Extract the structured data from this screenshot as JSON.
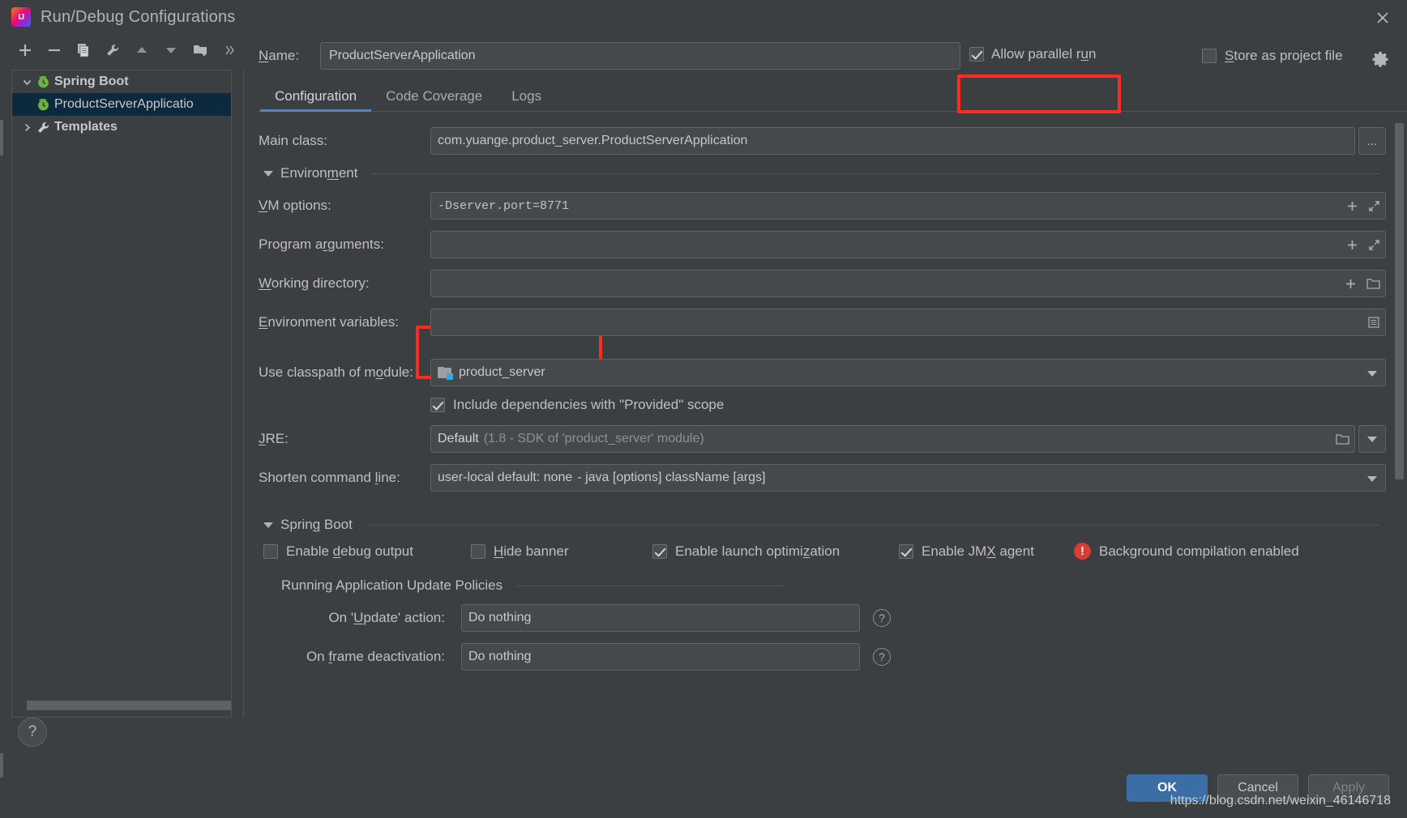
{
  "window": {
    "title": "Run/Debug Configurations",
    "logo_icon": "intellij-idea-logo",
    "close_icon": "close-icon"
  },
  "toolbar": {
    "buttons": [
      {
        "name": "add",
        "icon": "plus-icon"
      },
      {
        "name": "remove",
        "icon": "minus-icon"
      },
      {
        "name": "copy",
        "icon": "copy-icon"
      },
      {
        "name": "edit-templates",
        "icon": "wrench-icon"
      },
      {
        "name": "move-up",
        "icon": "arrow-up-icon"
      },
      {
        "name": "move-down",
        "icon": "arrow-down-icon"
      },
      {
        "name": "new-folder",
        "icon": "folder-add-icon"
      },
      {
        "name": "more",
        "icon": "chevron-double-right-icon"
      }
    ]
  },
  "tree": {
    "nodes": [
      {
        "label": "Spring Boot",
        "icon": "spring-boot-icon",
        "expanded": true,
        "selected": false
      },
      {
        "label": "ProductServerApplicatio",
        "icon": "spring-boot-icon",
        "child": true,
        "selected": true
      },
      {
        "label": "Templates",
        "icon": "wrench-icon",
        "expanded": false,
        "selected": false
      }
    ]
  },
  "help": {
    "label": "?"
  },
  "name_field": {
    "label": "Name:",
    "value": "ProductServerApplication",
    "placeholder": ""
  },
  "allow_parallel_run": {
    "label": "Allow parallel run",
    "checked": true,
    "highlighted": true
  },
  "store_as_project_file": {
    "label": "Store as project file",
    "checked": false,
    "gear_icon": "gear-icon"
  },
  "tabs": [
    {
      "label": "Configuration",
      "active": true
    },
    {
      "label": "Code Coverage",
      "active": false
    },
    {
      "label": "Logs",
      "active": false
    }
  ],
  "form": {
    "main_class": {
      "label": "Main class:",
      "value": "com.yuange.product_server.ProductServerApplication",
      "browse_label": "..."
    },
    "environment_section": {
      "label": "Environment",
      "expanded": true
    },
    "vm_options": {
      "label": "VM options:",
      "value": "-Dserver.port=8771",
      "highlighted": true,
      "expand_icon": "expand-icon",
      "add_icon": "plus-icon"
    },
    "program_arguments": {
      "label": "Program arguments:",
      "value": "",
      "expand_icon": "expand-icon",
      "add_icon": "plus-icon"
    },
    "working_directory": {
      "label": "Working directory:",
      "value": "",
      "browse_icon": "folder-icon",
      "add_icon": "plus-icon"
    },
    "environment_variables": {
      "label": "Environment variables:",
      "value": "",
      "browse_icon": "list-icon"
    },
    "use_classpath_of_module": {
      "label": "Use classpath of module:",
      "value": "product_server",
      "icon": "module-folder-icon"
    },
    "include_provided_scope": {
      "label": "Include dependencies with \"Provided\" scope",
      "checked": true
    },
    "jre": {
      "label": "JRE:",
      "value": "Default",
      "value_detail": "(1.8 - SDK of 'product_server' module)",
      "browse_icon": "folder-icon"
    },
    "shorten_command_line": {
      "label": "Shorten command line:",
      "value": "user-local default: none",
      "value_detail": "- java [options] className [args]"
    }
  },
  "spring_boot_section": {
    "label": "Spring Boot",
    "expanded": true,
    "checkboxes": [
      {
        "label": "Enable debug output",
        "checked": false
      },
      {
        "label": "Hide banner",
        "checked": false
      },
      {
        "label": "Enable launch optimization",
        "checked": true
      },
      {
        "label": "Enable JMX agent",
        "checked": true
      }
    ],
    "warning": {
      "icon": "error-icon",
      "text": "Background compilation enabled",
      "color": "#db3b30"
    }
  },
  "update_policies": {
    "title": "Running Application Update Policies",
    "rows": [
      {
        "label": "On 'Update' action:",
        "value": "Do nothing",
        "help_icon": "question-icon"
      },
      {
        "label": "On frame deactivation:",
        "value": "Do nothing",
        "help_icon": "question-icon"
      }
    ]
  },
  "footer": {
    "buttons": [
      {
        "label": "OK",
        "style": "primary"
      },
      {
        "label": "Cancel",
        "style": "default"
      },
      {
        "label": "Apply",
        "style": "disabled"
      }
    ]
  },
  "watermark": {
    "text": "https://blog.csdn.net/weixin_46146718"
  },
  "colors": {
    "accent": "#4a88c7",
    "primary_button": "#3b6ea5",
    "annotation": "#ff2b20",
    "selection": "#0d293e",
    "error": "#db3b30"
  }
}
